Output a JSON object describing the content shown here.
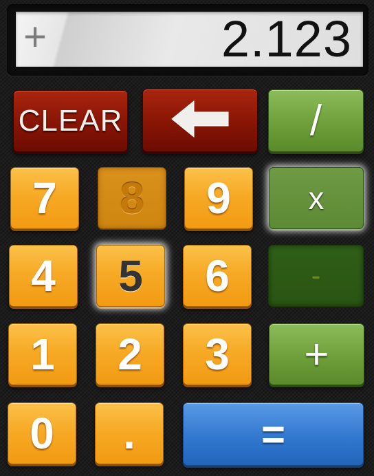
{
  "display": {
    "operator": "+",
    "value": "2.123"
  },
  "keys": {
    "clear": "CLEAR",
    "divide": "/",
    "seven": "7",
    "eight": "8",
    "nine": "9",
    "multiply": "x",
    "four": "4",
    "five": "5",
    "six": "6",
    "subtract": "-",
    "one": "1",
    "two": "2",
    "three": "3",
    "add": "+",
    "zero": "0",
    "decimal": ".",
    "equals": "="
  },
  "icons": {
    "backspace": "left-arrow-icon"
  },
  "colors": {
    "number_key": "#f7aa26",
    "clear_key": "#8a1605",
    "operator_key": "#6f9f3a",
    "equals_key": "#3278d0",
    "display_bg": "#e6e6e6"
  }
}
